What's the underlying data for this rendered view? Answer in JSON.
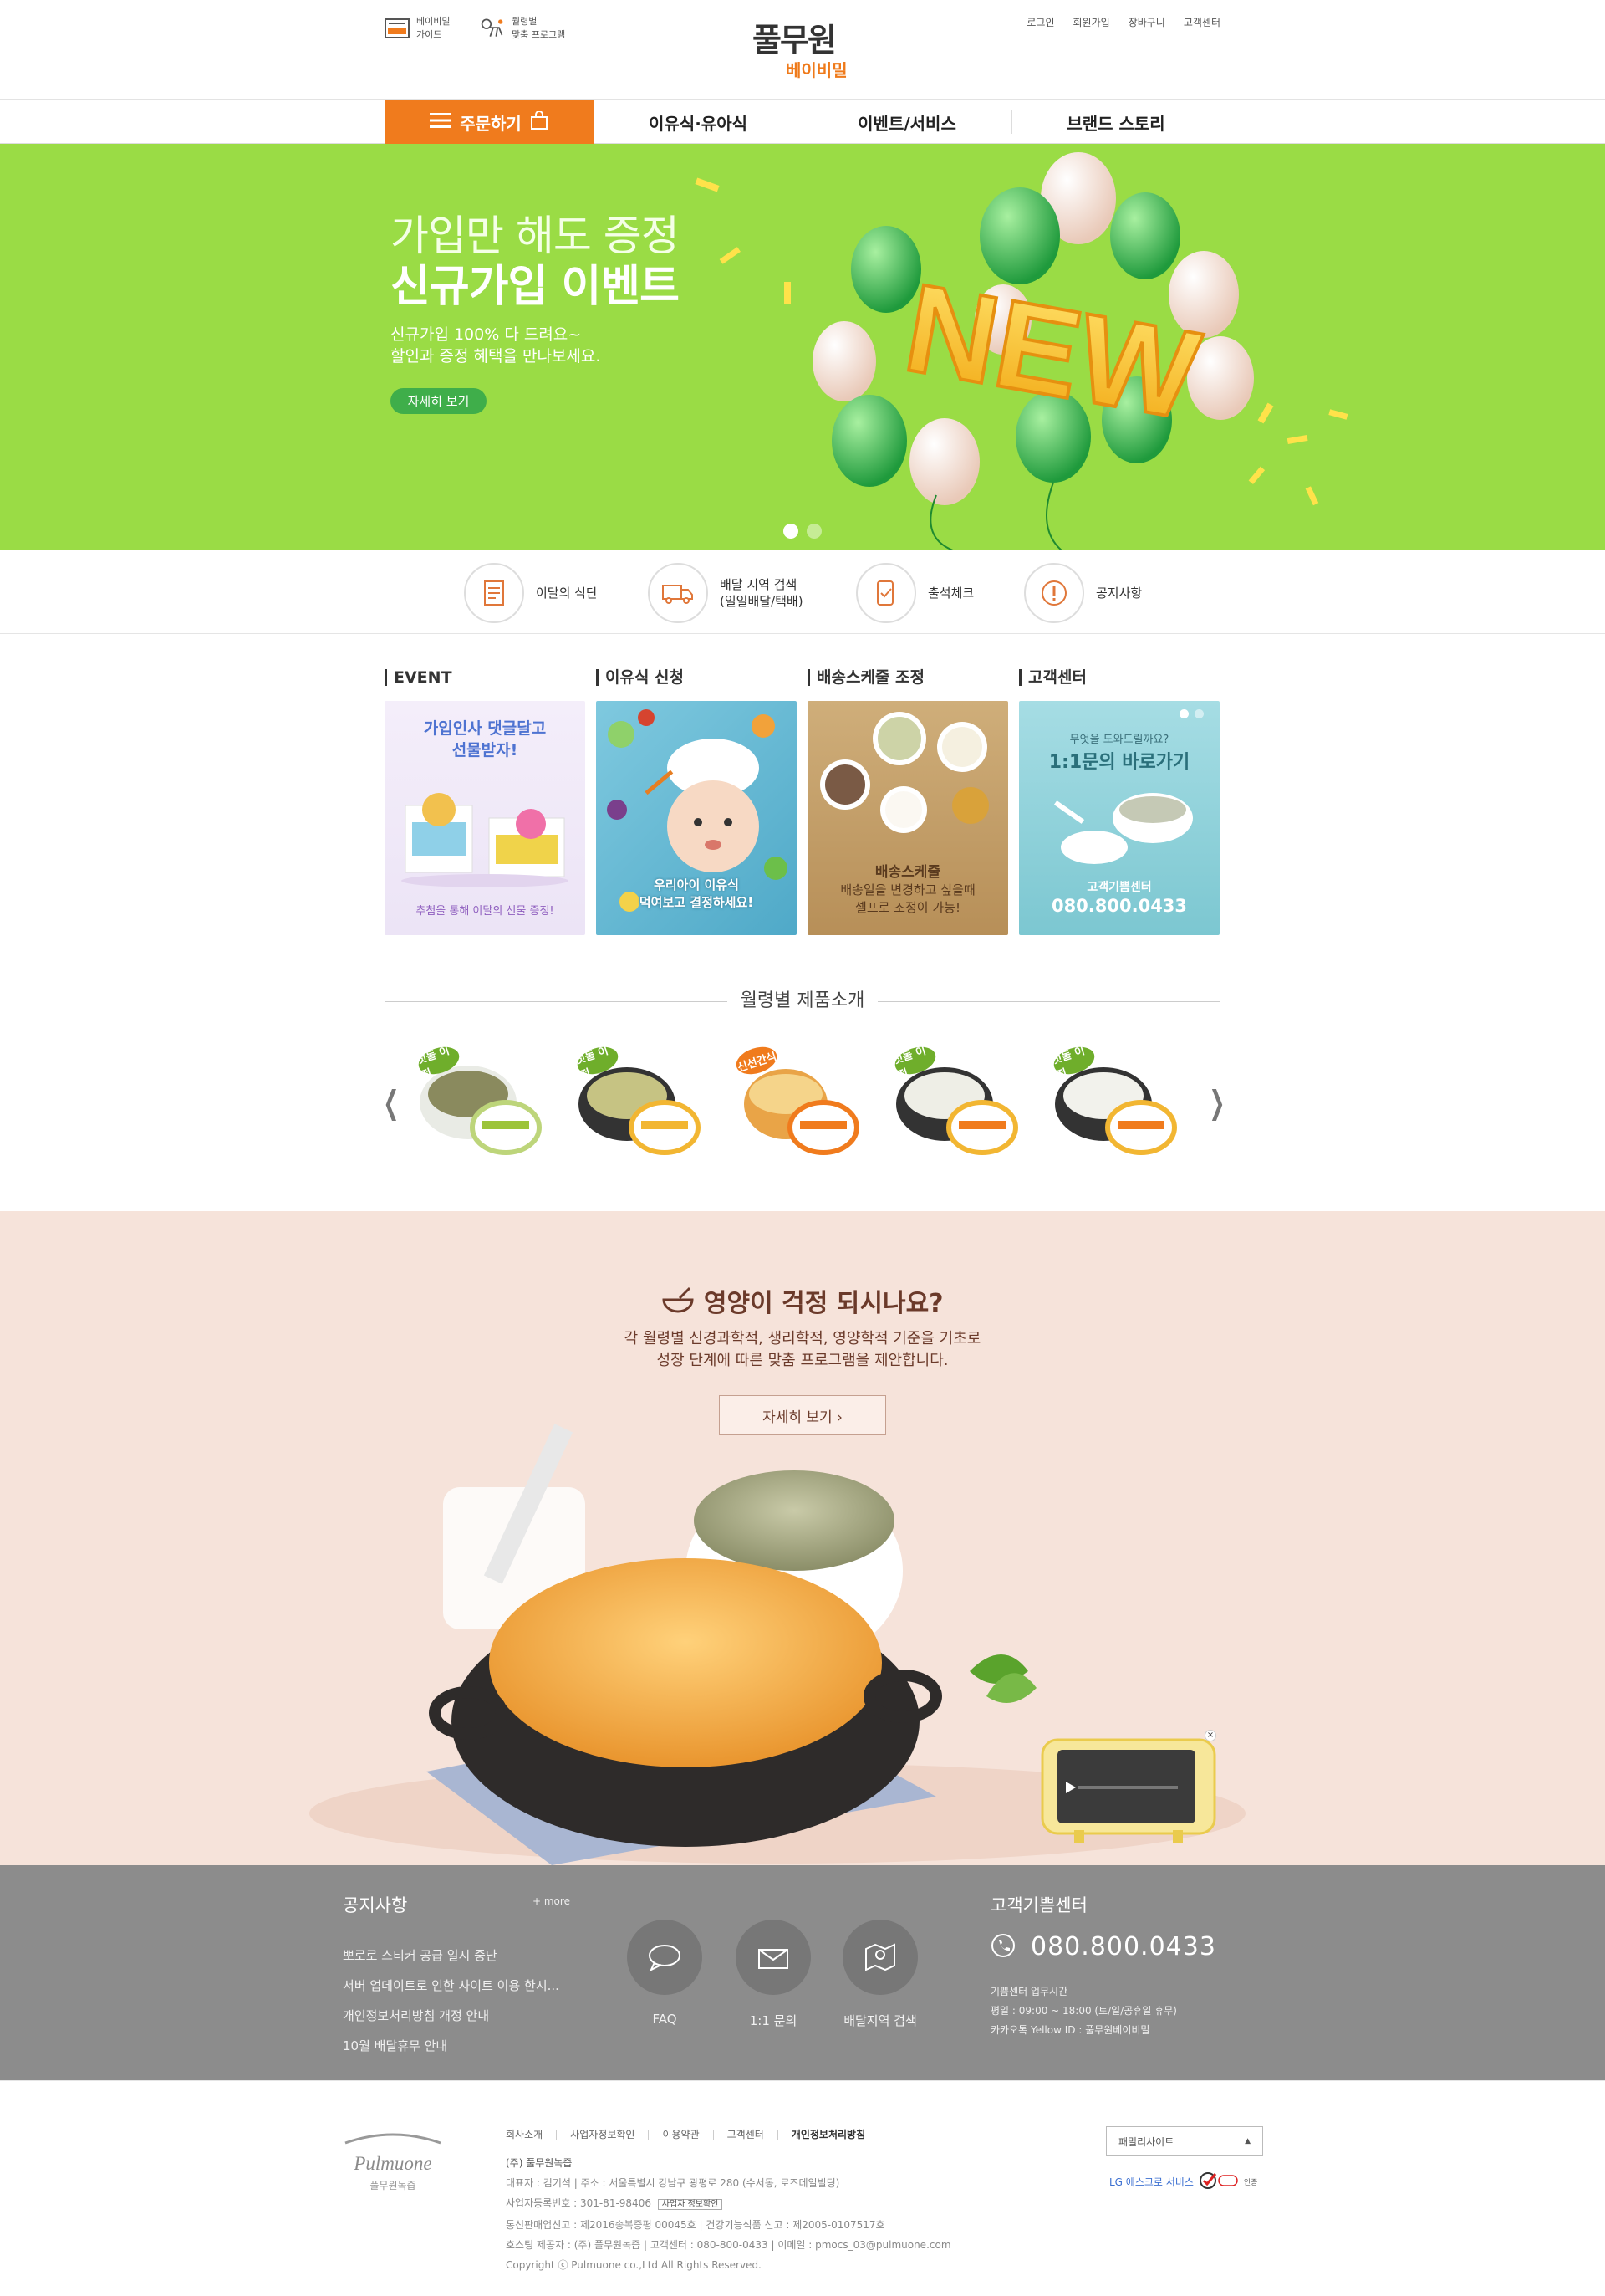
{
  "header": {
    "guide_left_1": "베이비밀",
    "guide_left_2": "가이드",
    "guide_right_1": "월령별",
    "guide_right_2": "맞춤 프로그램",
    "logo_main": "풀무원",
    "logo_sub": "베이비밀",
    "util_links": [
      "로그인",
      "회원가입",
      "장바구니",
      "고객센터"
    ]
  },
  "gnb": {
    "order": "주문하기",
    "items": [
      "이유식·유아식",
      "이벤트/서비스",
      "브랜드 스토리"
    ]
  },
  "hero": {
    "title_light": "가입만 해도 증정",
    "title_bold": "신규가입 이벤트",
    "desc1": "신규가입 100% 다 드려요~",
    "desc2": "할인과 증정 혜택을 만나보세요.",
    "button": "자세히 보기",
    "balloon_text": "NEW",
    "colors": {
      "bg": "#9adc45",
      "button": "#3fae4a"
    }
  },
  "quick": [
    {
      "label": "이달의 식단",
      "icon": "menu-list-icon"
    },
    {
      "label1": "배달 지역 검색",
      "label2": "(일일배달/택배)",
      "icon": "delivery-truck-icon"
    },
    {
      "label": "출석체크",
      "icon": "attendance-check-icon"
    },
    {
      "label": "공지사항",
      "icon": "notice-exclamation-icon"
    }
  ],
  "cards": [
    {
      "title": "EVENT",
      "cap1": "가입인사 댓글달고",
      "cap2": "선물받자!",
      "bottom": "추첨을 통해 이달의 선물 증정!"
    },
    {
      "title": "이유식 신청",
      "cap1": "우리아이 이유식",
      "cap2": "먹여보고 결정하세요!"
    },
    {
      "title": "배송스케줄 조정",
      "cap1": "배송스케줄",
      "cap2": "배송일을 변경하고 싶을때",
      "cap3": "셀프로 조정이 가능!"
    },
    {
      "title": "고객센터",
      "cap1": "무엇을 도와드릴까요?",
      "cap2": "1:1문의 바로가기",
      "cap3": "고객기쁨센터",
      "cap4": "080.800.0433"
    }
  ],
  "month_products": {
    "title": "월령별 제품소개",
    "tags": [
      "첫돌 이전",
      "첫돌 이전",
      "신선간식",
      "첫돌 이전",
      "첫돌 이전"
    ]
  },
  "nutrition": {
    "title": "영양이 걱정 되시나요?",
    "desc1": "각 월령별 신경과학적, 생리학적, 영양학적 기준을 기초로",
    "desc2": "성장 단계에 따른 맞춤 프로그램을 제안합니다.",
    "button": "자세히 보기 ›"
  },
  "info": {
    "notice_title": "공지사항",
    "more": "+ more",
    "notices": [
      "뽀로로 스티커 공급 일시 중단",
      "서버 업데이트로 인한 사이트 이용 한시...",
      "개인정보처리방침 개정 안내",
      "10월 배달휴무 안내"
    ],
    "faq": "FAQ",
    "inquiry": "1:1 문의",
    "area": "배달지역 검색",
    "center_title": "고객기쁨센터",
    "phone": "080.800.0433",
    "hours_title": "기쁨센터 업무시간",
    "hours": "평일 : 09:00 ~ 18:00 (토/일/공휴일 휴무)",
    "kakao": "카카오톡 Yellow ID : 풀무원베이비밀"
  },
  "footer": {
    "brand": "Pulmuone",
    "brand_sub": "풀무원녹즙",
    "links": [
      "회사소개",
      "사업자정보확인",
      "이용약관",
      "고객센터",
      "개인정보처리방침"
    ],
    "company": "(주) 풀무원녹즙",
    "line1": "대표자 : 김기석 | 주소 : 서울특별시 강남구 광평로 280 (수서동, 로즈데일빌딩)",
    "line2": "사업자등록번호 : 301-81-98406",
    "biz_check": "사업자 정보확인",
    "line3": "통신판매업신고 : 제2016송복증평 00045호  |  건강기능식품 신고 : 제2005-0107517호",
    "line4": "호스팅 제공자 : (주) 풀무원녹즙 | 고객센터 : 080-800-0433 | 이메일 : pmocs_03@pulmuone.com",
    "copyright": "Copyright ⓒ Pulmuone co.,Ltd All Rights Reserved.",
    "family": "패밀리사이트",
    "escrow": "LG 에스크로 서비스",
    "escrow_tail": "인증"
  }
}
